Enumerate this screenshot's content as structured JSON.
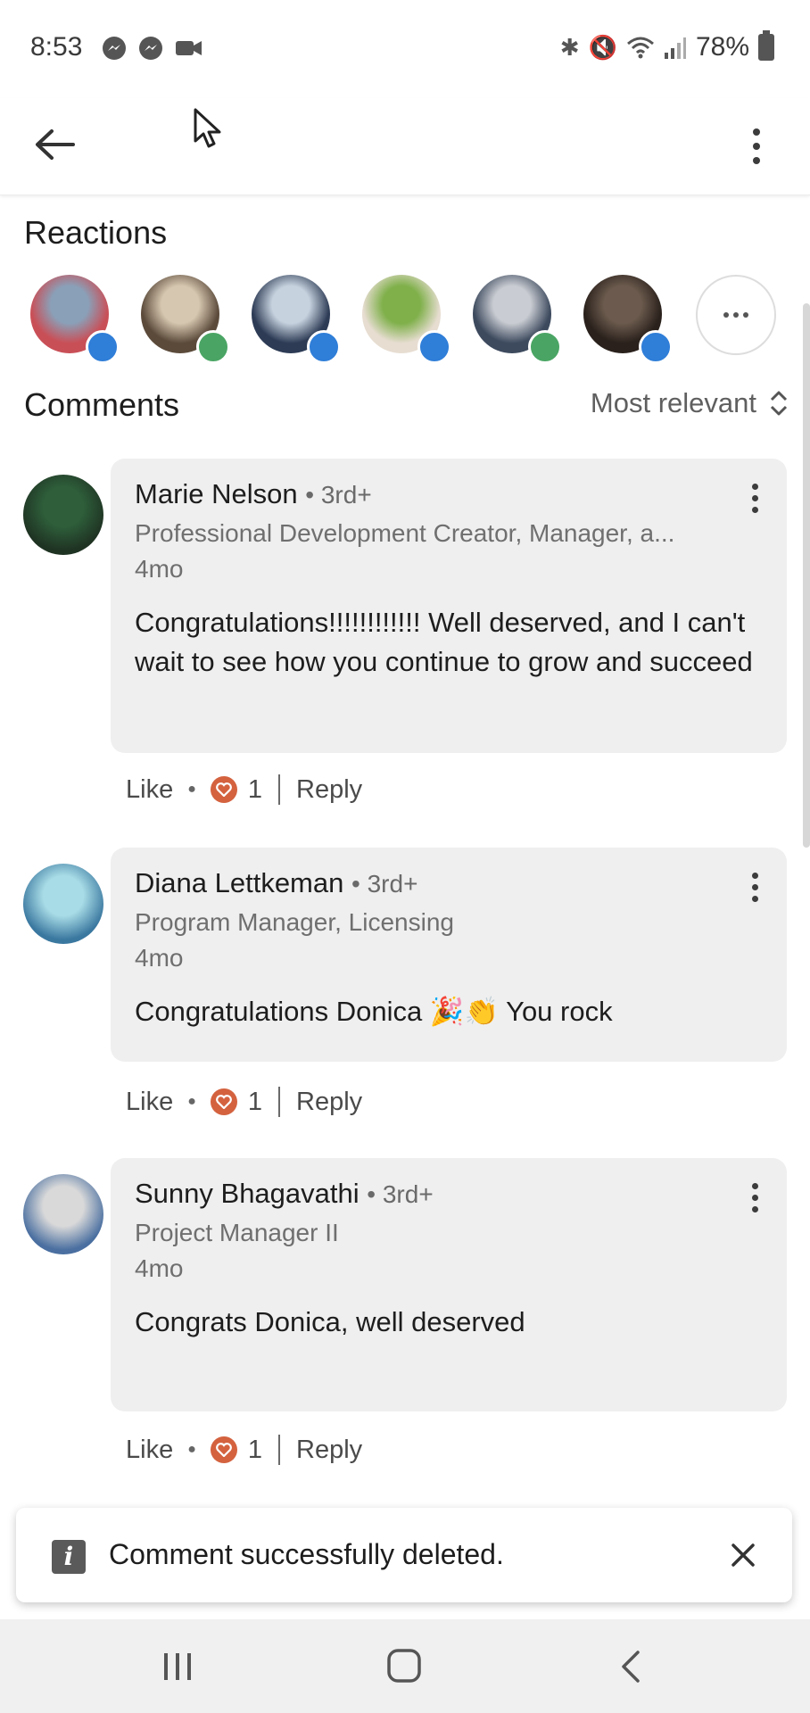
{
  "status_bar": {
    "time": "8:53",
    "battery": "78%",
    "left_icons": [
      "messenger-icon",
      "messenger-icon",
      "video-camera-icon"
    ],
    "right_icons": [
      "bluetooth-icon",
      "mute-icon",
      "wifi-icon",
      "signal-icon",
      "battery-icon"
    ]
  },
  "top_bar": {
    "back_icon": "arrow-left-icon",
    "menu_icon": "more-vertical-icon"
  },
  "reactions": {
    "title": "Reactions",
    "avatars": [
      {
        "badge": "like",
        "colors": [
          "#8aa0b8",
          "#c94f57"
        ]
      },
      {
        "badge": "clap",
        "colors": [
          "#d6c7b0",
          "#5b4a3a"
        ]
      },
      {
        "badge": "like",
        "colors": [
          "#c6d2de",
          "#2d3b55"
        ]
      },
      {
        "badge": "like",
        "colors": [
          "#7fb04a",
          "#e7ddd1"
        ]
      },
      {
        "badge": "clap",
        "colors": [
          "#c9ccd2",
          "#3d4a5e"
        ]
      },
      {
        "badge": "like",
        "colors": [
          "#6b5a4d",
          "#2a211c"
        ]
      }
    ],
    "more_icon": "more-horizontal-icon"
  },
  "comments_section": {
    "title": "Comments",
    "sort_label": "Most relevant"
  },
  "comments": [
    {
      "name": "Marie Nelson",
      "degree": "3rd+",
      "headline": "Professional Development Creator, Manager, a...",
      "time": "4mo",
      "text": "Congratulations!!!!!!!!!!!! Well deserved, and I can't wait to see how you continue to grow and succeed",
      "like_label": "Like",
      "reaction_count": "1",
      "reply_label": "Reply",
      "avatar_colors": [
        "#2e5e3a",
        "#1f3323"
      ]
    },
    {
      "name": "Diana Lettkeman",
      "degree": "3rd+",
      "headline": "Program Manager, Licensing",
      "time": "4mo",
      "text": "Congratulations Donica 🎉👏 You rock",
      "like_label": "Like",
      "reaction_count": "1",
      "reply_label": "Reply",
      "avatar_colors": [
        "#a8dce6",
        "#3b78a0"
      ]
    },
    {
      "name": "Sunny Bhagavathi",
      "degree": "3rd+",
      "headline": "Project Manager II",
      "time": "4mo",
      "text": "Congrats Donica, well deserved",
      "like_label": "Like",
      "reaction_count": "1",
      "reply_label": "Reply",
      "avatar_colors": [
        "#d9d9d9",
        "#4a6fa0"
      ]
    }
  ],
  "toast": {
    "message": "Comment successfully deleted.",
    "info_icon": "info-icon",
    "close_icon": "close-icon"
  },
  "nav_bar": {
    "icons": [
      "recent-apps-icon",
      "home-icon",
      "back-icon"
    ]
  },
  "colors": {
    "like_badge": "#2f7ed8",
    "clap_badge": "#4aa564",
    "heart": "#d4623f",
    "bubble_bg": "#efefef"
  }
}
